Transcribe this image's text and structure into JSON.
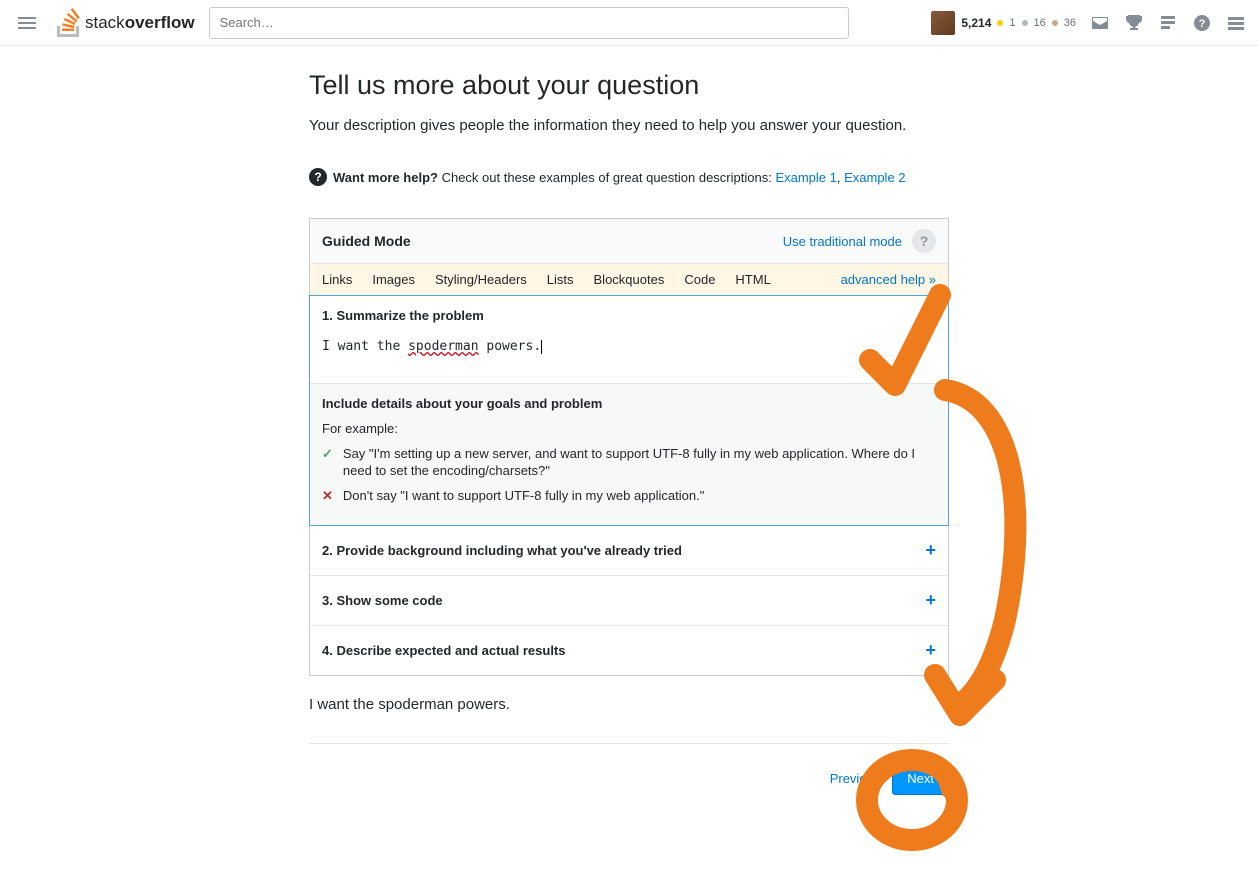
{
  "header": {
    "search_placeholder": "Search…",
    "reputation": "5,214",
    "badges": {
      "gold": "1",
      "silver": "16",
      "bronze": "36"
    }
  },
  "page": {
    "title": "Tell us more about your question",
    "subtitle": "Your description gives people the information they need to help you answer your question."
  },
  "help": {
    "want_more": "Want more help?",
    "check_out": " Check out these examples of great question descriptions: ",
    "example1": "Example 1",
    "comma": ", ",
    "example2": "Example 2"
  },
  "editor": {
    "mode_title": "Guided Mode",
    "traditional_link": "Use traditional mode",
    "toolbar": {
      "links": "Links",
      "images": "Images",
      "styling": "Styling/Headers",
      "lists": "Lists",
      "blockquotes": "Blockquotes",
      "code": "Code",
      "html": "HTML",
      "advanced": "advanced help »"
    },
    "step1": {
      "title": "1. Summarize the problem",
      "input_prefix": "I want the ",
      "input_misspell": "spoderman",
      "input_suffix": " powers.",
      "hints_title": "Include details about your goals and problem",
      "for_example": "For example:",
      "good": "Say \"I'm setting up a new server, and want to support UTF-8 fully in my web application. Where do I need to set the encoding/charsets?\"",
      "bad": "Don't say \"I want to support UTF-8 fully in my web application.\""
    },
    "step2": "2. Provide background including what you've already tried",
    "step3": "3. Show some code",
    "step4": "4. Describe expected and actual results"
  },
  "preview": "I want the spoderman powers.",
  "nav": {
    "prev": "Previous",
    "next": "Next"
  }
}
